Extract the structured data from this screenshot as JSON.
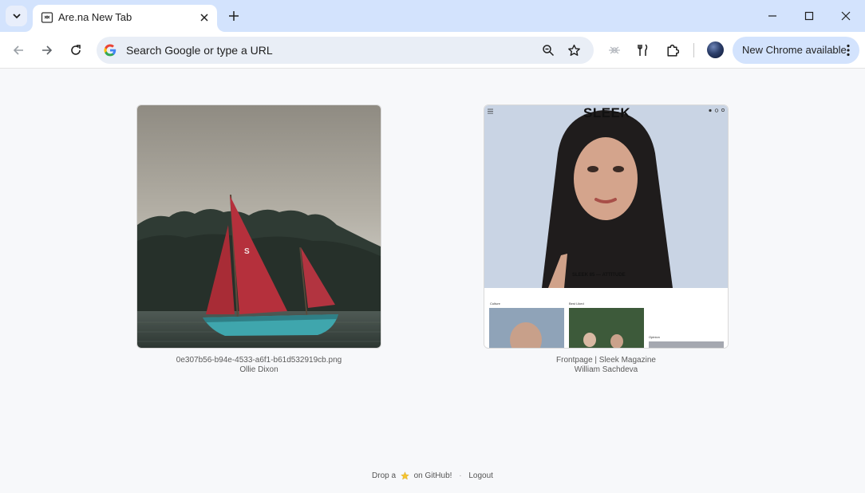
{
  "browser": {
    "tab": {
      "title": "Are.na New Tab"
    },
    "omnibox": {
      "placeholder": "Search Google or type a URL"
    },
    "update_button": {
      "label": "New Chrome available"
    }
  },
  "page": {
    "cards": [
      {
        "title": "0e307b56-b94e-4533-a6f1-b61d532919cb.png",
        "author": "Ollie Dixon"
      },
      {
        "title": "Frontpage | Sleek Magazine",
        "author": "William Sachdeva"
      }
    ],
    "sleek_preview": {
      "masthead": "SLEEK",
      "issue_label": "SLEEK 85 — ATTITUDE",
      "sections": [
        "Culture",
        "Best Liked",
        "Opinion"
      ]
    },
    "sail_mark": "S",
    "footer": {
      "drop_prefix": "Drop a",
      "drop_suffix": "on GitHub!",
      "separator": "·",
      "logout": "Logout"
    }
  },
  "colors": {
    "tabstrip": "#d3e3fd",
    "omnibox": "#e9eef6",
    "sail": "#b5303c",
    "hull": "#3fa6ad",
    "star": "#f4c430"
  },
  "icons": [
    "tab-search-icon",
    "arena-favicon",
    "close-icon",
    "plus-icon",
    "minimize-icon",
    "maximize-icon",
    "window-close-icon",
    "back-arrow-icon",
    "forward-arrow-icon",
    "reload-icon",
    "google-logo-icon",
    "zoom-icon",
    "bookmark-star-icon",
    "extension-dim-icon",
    "labs-icon",
    "puzzle-icon",
    "kebab-menu-icon",
    "star-emoji-icon"
  ]
}
